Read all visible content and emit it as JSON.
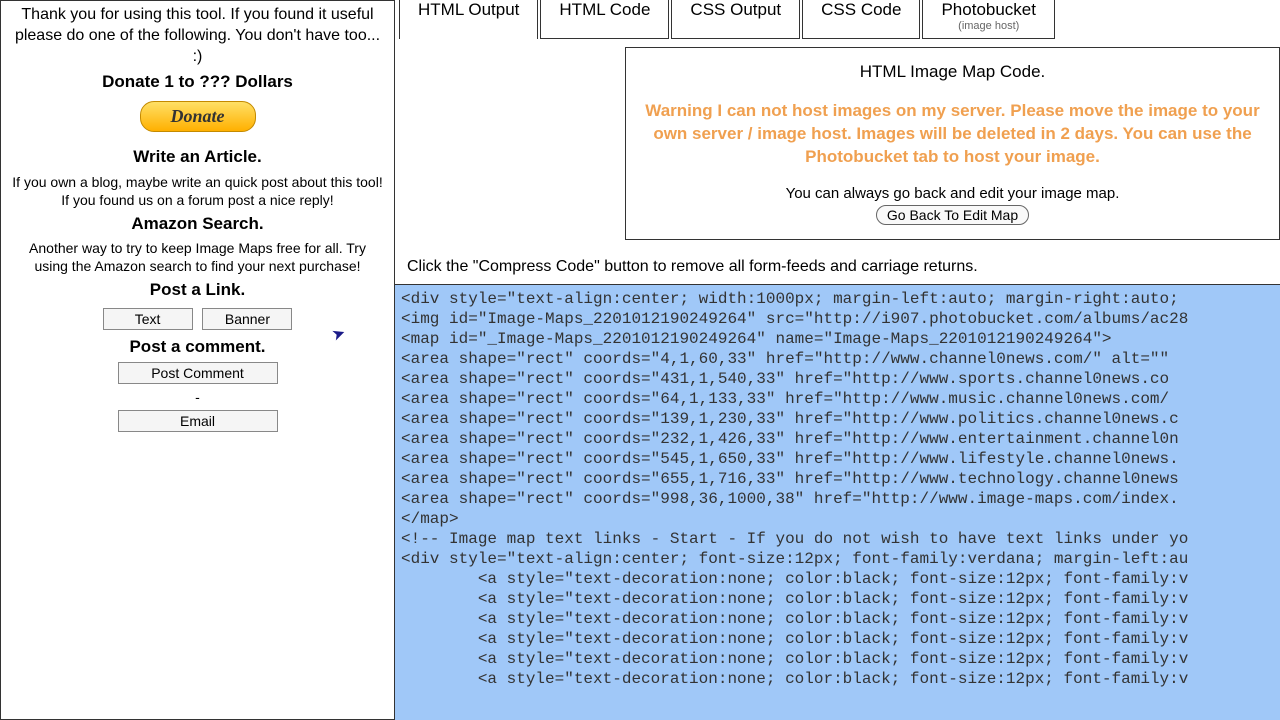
{
  "sidebar": {
    "thanks": "Thank you for using this tool. If you found it useful please do one of the following. You don't have too... :)",
    "donate_heading": "Donate 1 to ??? Dollars",
    "donate_label": "Donate",
    "article_heading": "Write an Article.",
    "article_text": "If you own a blog, maybe write an quick post about this tool! If you found us on a forum post a nice reply!",
    "amazon_heading": "Amazon Search.",
    "amazon_text": "Another way to try to keep Image Maps free for all. Try using the Amazon search to find your next purchase!",
    "post_link_heading": "Post a Link.",
    "text_label": "Text",
    "banner_label": "Banner",
    "comment_heading": "Post a comment.",
    "post_comment_label": "Post Comment",
    "dash": "-",
    "email_label": "Email"
  },
  "tabs": [
    {
      "label": "HTML Output"
    },
    {
      "label": "HTML Code"
    },
    {
      "label": "CSS Output"
    },
    {
      "label": "CSS Code"
    },
    {
      "label": "Photobucket",
      "sub": "(image host)"
    }
  ],
  "content": {
    "title": "HTML Image Map Code.",
    "warning": "Warning I can not host images on my server. Please move the image to your own server / image host. Images will be deleted in 2 days. You can use the Photobucket tab to host your image.",
    "go_back_text": "You can always go back and edit your image map.",
    "go_back_label": "Go Back To Edit Map",
    "compress_note": "Click the \"Compress Code\" button to remove all form-feeds and carriage returns."
  },
  "code_lines": [
    "<div style=\"text-align:center; width:1000px; margin-left:auto; margin-right:auto;",
    "<img id=\"Image-Maps_2201012190249264\" src=\"http://i907.photobucket.com/albums/ac28",
    "<map id=\"_Image-Maps_2201012190249264\" name=\"Image-Maps_2201012190249264\">",
    "<area shape=\"rect\" coords=\"4,1,60,33\" href=\"http://www.channel0news.com/\" alt=\"\" ",
    "<area shape=\"rect\" coords=\"431,1,540,33\" href=\"http://www.sports.channel0news.co",
    "<area shape=\"rect\" coords=\"64,1,133,33\" href=\"http://www.music.channel0news.com/",
    "<area shape=\"rect\" coords=\"139,1,230,33\" href=\"http://www.politics.channel0news.c",
    "<area shape=\"rect\" coords=\"232,1,426,33\" href=\"http://www.entertainment.channel0n",
    "<area shape=\"rect\" coords=\"545,1,650,33\" href=\"http://www.lifestyle.channel0news.",
    "<area shape=\"rect\" coords=\"655,1,716,33\" href=\"http://www.technology.channel0news",
    "<area shape=\"rect\" coords=\"998,36,1000,38\" href=\"http://www.image-maps.com/index.",
    "</map>",
    "<!-- Image map text links - Start - If you do not wish to have text links under yo",
    "<div style=\"text-align:center; font-size:12px; font-family:verdana; margin-left:au",
    "        <a style=\"text-decoration:none; color:black; font-size:12px; font-family:v",
    "        <a style=\"text-decoration:none; color:black; font-size:12px; font-family:v",
    "        <a style=\"text-decoration:none; color:black; font-size:12px; font-family:v",
    "        <a style=\"text-decoration:none; color:black; font-size:12px; font-family:v",
    "        <a style=\"text-decoration:none; color:black; font-size:12px; font-family:v",
    "        <a style=\"text-decoration:none; color:black; font-size:12px; font-family:v"
  ]
}
